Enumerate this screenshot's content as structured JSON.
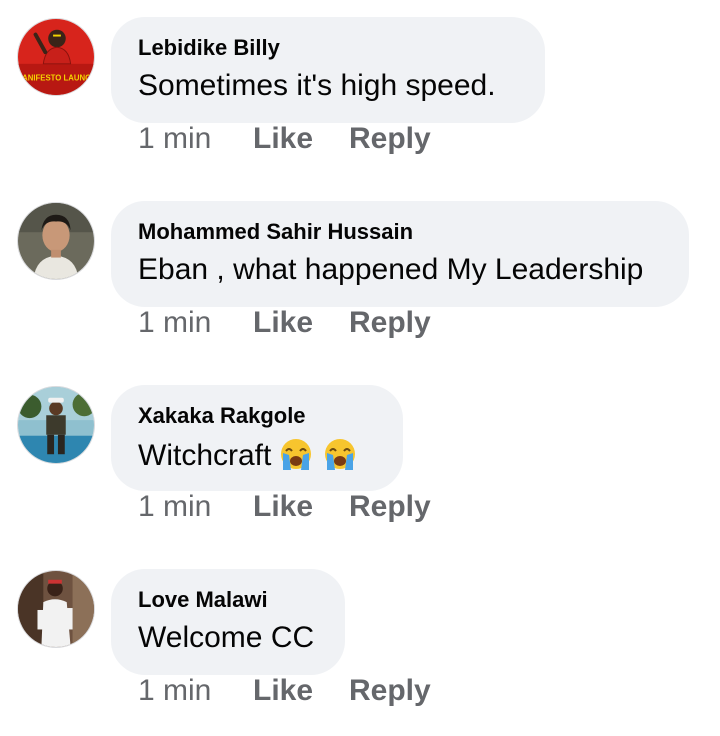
{
  "comments": [
    {
      "author": "Lebidike Billy",
      "text": "Sometimes it's high speed.",
      "time": "1 min",
      "like": "Like",
      "reply": "Reply",
      "avatar_text": "MANIFESTO LAUNCH",
      "avatar_colors": {
        "bg": "#d7241c",
        "accent": "#f3d400"
      }
    },
    {
      "author": "Mohammed Sahir Hussain",
      "text": "Eban , what happened My Leadership",
      "time": "1 min",
      "like": "Like",
      "reply": "Reply",
      "avatar_colors": {
        "bg": "#6b6a5c",
        "accent": "#e9e7e0"
      }
    },
    {
      "author": "Xakaka Rakgole",
      "text": "Witchcraft",
      "emoji": [
        "crying-face-emoji",
        "crying-face-emoji"
      ],
      "time": "1 min",
      "like": "Like",
      "reply": "Reply",
      "avatar_colors": {
        "bg": "#6aa7b8",
        "accent": "#3b5c2e"
      }
    },
    {
      "author": "Love Malawi",
      "text": "Welcome CC",
      "time": "1 min",
      "like": "Like",
      "reply": "Reply",
      "avatar_colors": {
        "bg": "#7a5a44",
        "accent": "#f2f2f2"
      }
    }
  ],
  "theme": {
    "bubble_bg": "#f0f2f5",
    "text_color": "#050505",
    "meta_color": "#65676b"
  }
}
